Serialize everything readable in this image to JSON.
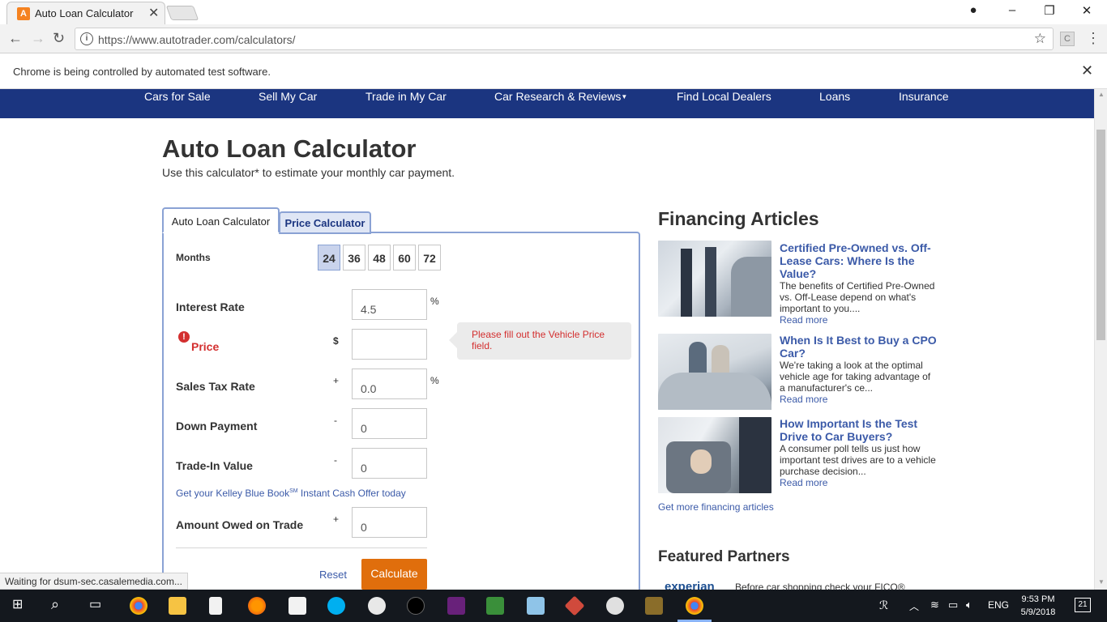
{
  "browser": {
    "tab_title": "Auto Loan Calculator",
    "url": "https://www.autotrader.com/calculators/",
    "infobar_message": "Chrome is being controlled by automated test software.",
    "status_text": "Waiting for dsum-sec.casalemedia.com..."
  },
  "nav": {
    "items": [
      "Cars for Sale",
      "Sell My Car",
      "Trade in My Car",
      "Car Research & Reviews",
      "Find Local Dealers",
      "Loans",
      "Insurance"
    ]
  },
  "page": {
    "title": "Auto Loan Calculator",
    "subtitle": "Use this calculator* to estimate your monthly car payment."
  },
  "calculator": {
    "tabs": [
      "Auto Loan Calculator",
      "Price Calculator"
    ],
    "months_label": "Months",
    "months": [
      "24",
      "36",
      "48",
      "60",
      "72"
    ],
    "selected_month": "24",
    "interest_rate": {
      "label": "Interest Rate",
      "value": "4.5",
      "unit": "%"
    },
    "price": {
      "label": "Price",
      "sign": "$",
      "value": "",
      "error": "Please fill out the Vehicle Price field."
    },
    "sales_tax": {
      "label": "Sales Tax Rate",
      "sign": "+",
      "value": "0.0",
      "unit": "%"
    },
    "down_payment": {
      "label": "Down Payment",
      "sign": "-",
      "value": "0"
    },
    "trade_in": {
      "label": "Trade-In Value",
      "sign": "-",
      "value": "0"
    },
    "kbb_link_pre": "Get your Kelley Blue Book",
    "kbb_link_sup": "SM",
    "kbb_link_post": " Instant Cash Offer today",
    "amount_owed": {
      "label": "Amount Owed on Trade",
      "sign": "+",
      "value": "0"
    },
    "reset_label": "Reset",
    "calculate_label": "Calculate"
  },
  "financing": {
    "title": "Financing Articles",
    "articles": [
      {
        "title": "Certified Pre-Owned vs. Off-Lease Cars: Where Is the Value?",
        "desc": "The benefits of Certified Pre-Owned vs. Off-Lease depend on what's important to you....",
        "more": "Read more"
      },
      {
        "title": "When Is It Best to Buy a CPO Car?",
        "desc": "We're taking a look at the optimal vehicle age for taking advantage of a manufacturer's ce...",
        "more": "Read more"
      },
      {
        "title": "How Important Is the Test Drive to Car Buyers?",
        "desc": "A consumer poll tells us just how important test drives are to a vehicle purchase decision...",
        "more": "Read more"
      }
    ],
    "more_link": "Get more financing articles",
    "partners_title": "Featured Partners",
    "partner_logo": "experian",
    "partner_text": "Before car shopping check your FICO®"
  },
  "taskbar": {
    "time": "9:53 PM",
    "date": "5/9/2018",
    "lang": "ENG",
    "notifications": "21"
  }
}
